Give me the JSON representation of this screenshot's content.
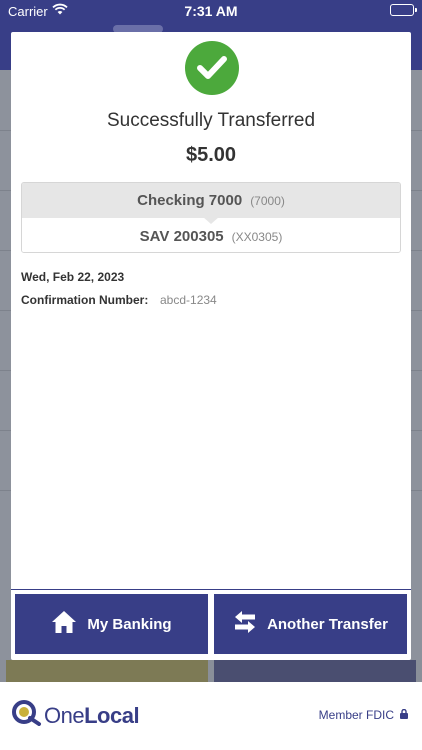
{
  "status_bar": {
    "carrier": "Carrier",
    "time": "7:31 AM"
  },
  "confirmation": {
    "title": "Successfully Transferred",
    "amount": "$5.00",
    "from_account": {
      "name": "Checking 7000",
      "number": "(7000)"
    },
    "to_account": {
      "name": "SAV 200305",
      "number": "(XX0305)"
    },
    "date": "Wed, Feb 22, 2023",
    "confirmation_label": "Confirmation Number:",
    "confirmation_number": "abcd-1234"
  },
  "actions": {
    "my_banking_label": "My Banking",
    "another_transfer_label": "Another Transfer"
  },
  "footer": {
    "logo_regular": "One",
    "logo_bold": "Local",
    "fdic_label": "Member FDIC"
  },
  "colors": {
    "primary": "#383e87",
    "success": "#4ca93c"
  },
  "icons": [
    "wifi-icon",
    "battery-icon",
    "checkmark-icon",
    "home-icon",
    "transfer-arrows-icon",
    "onelocal-logo-icon",
    "lock-icon"
  ]
}
